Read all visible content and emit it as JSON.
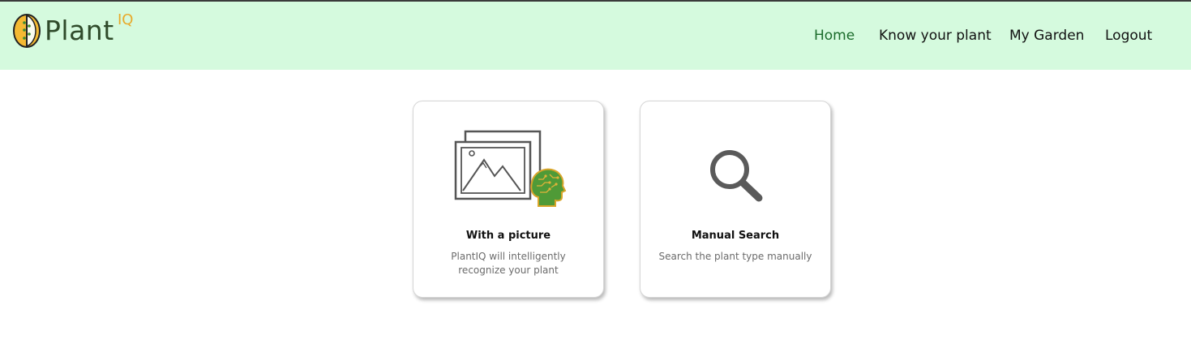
{
  "brand": {
    "name": "Plant",
    "superscript": "IQ",
    "colors": {
      "navbar": "#d5fade",
      "accent": "#e8a92a",
      "active_link": "#1a6b2a"
    }
  },
  "nav": {
    "home": "Home",
    "know_your_plant": "Know your plant",
    "my_garden": "My Garden",
    "logout": "Logout",
    "active": "Home"
  },
  "options": [
    {
      "icon": "image-ai-recognition-icon",
      "title": "With a picture",
      "description": "PlantIQ will intelligently recognize your plant"
    },
    {
      "icon": "search-icon",
      "title": "Manual Search",
      "description": "Search the plant type manually"
    }
  ]
}
